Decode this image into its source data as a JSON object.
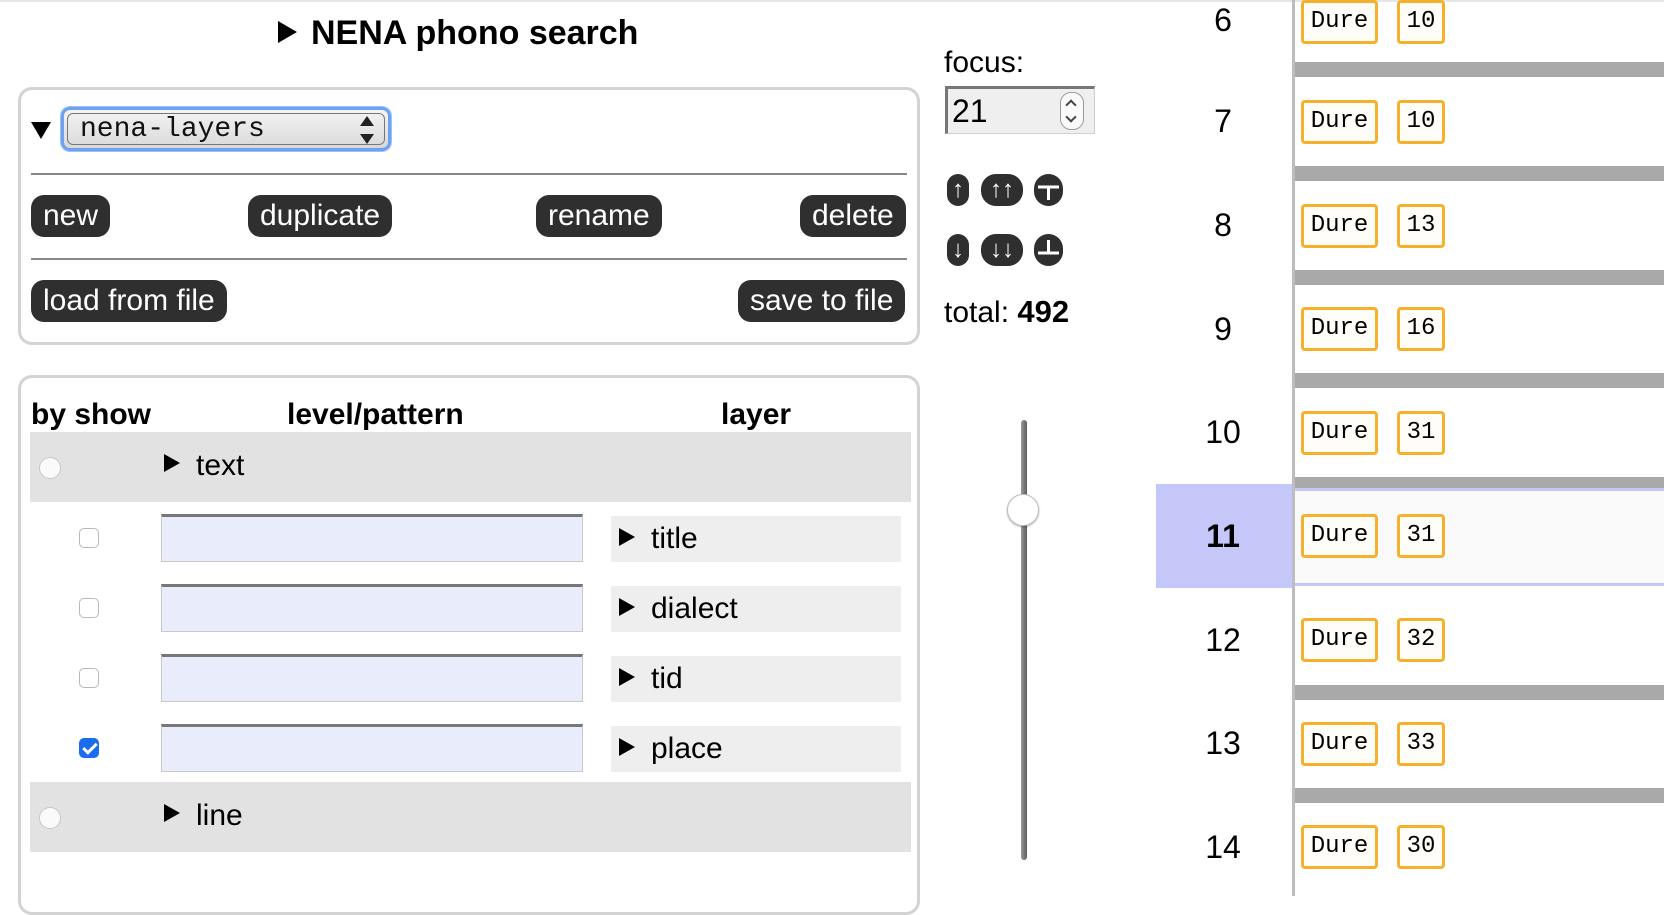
{
  "title": "NENA phono search",
  "layerset": {
    "selected": "nena-layers",
    "buttons": {
      "new": "new",
      "duplicate": "duplicate",
      "rename": "rename",
      "delete": "delete",
      "load": "load from file",
      "save": "save to file"
    }
  },
  "table": {
    "headers": {
      "by_show": "by show",
      "level_pattern": "level/pattern",
      "layer": "layer"
    },
    "groups": [
      {
        "label": "text"
      },
      {
        "label": "line"
      }
    ],
    "rows": [
      {
        "layer": "title",
        "checked": false,
        "pattern": ""
      },
      {
        "layer": "dialect",
        "checked": false,
        "pattern": ""
      },
      {
        "layer": "tid",
        "checked": false,
        "pattern": ""
      },
      {
        "layer": "place",
        "checked": true,
        "pattern": ""
      }
    ]
  },
  "nav": {
    "focus_label": "focus:",
    "focus_value": "21",
    "total_label": "total:",
    "total_value": "492",
    "slider_position_fraction": 0.18
  },
  "results": [
    {
      "num": "6",
      "word": "Dure",
      "value": "10"
    },
    {
      "num": "7",
      "word": "Dure",
      "value": "10"
    },
    {
      "num": "8",
      "word": "Dure",
      "value": "13"
    },
    {
      "num": "9",
      "word": "Dure",
      "value": "16"
    },
    {
      "num": "10",
      "word": "Dure",
      "value": "31"
    },
    {
      "num": "11",
      "word": "Dure",
      "value": "31",
      "current": true
    },
    {
      "num": "12",
      "word": "Dure",
      "value": "32"
    },
    {
      "num": "13",
      "word": "Dure",
      "value": "33"
    },
    {
      "num": "14",
      "word": "Dure",
      "value": "30"
    }
  ],
  "colors": {
    "accent": "#f5b02c",
    "highlight": "#c6c7f9",
    "button": "#2f2f2f",
    "select_border": "#6ea2ee"
  }
}
